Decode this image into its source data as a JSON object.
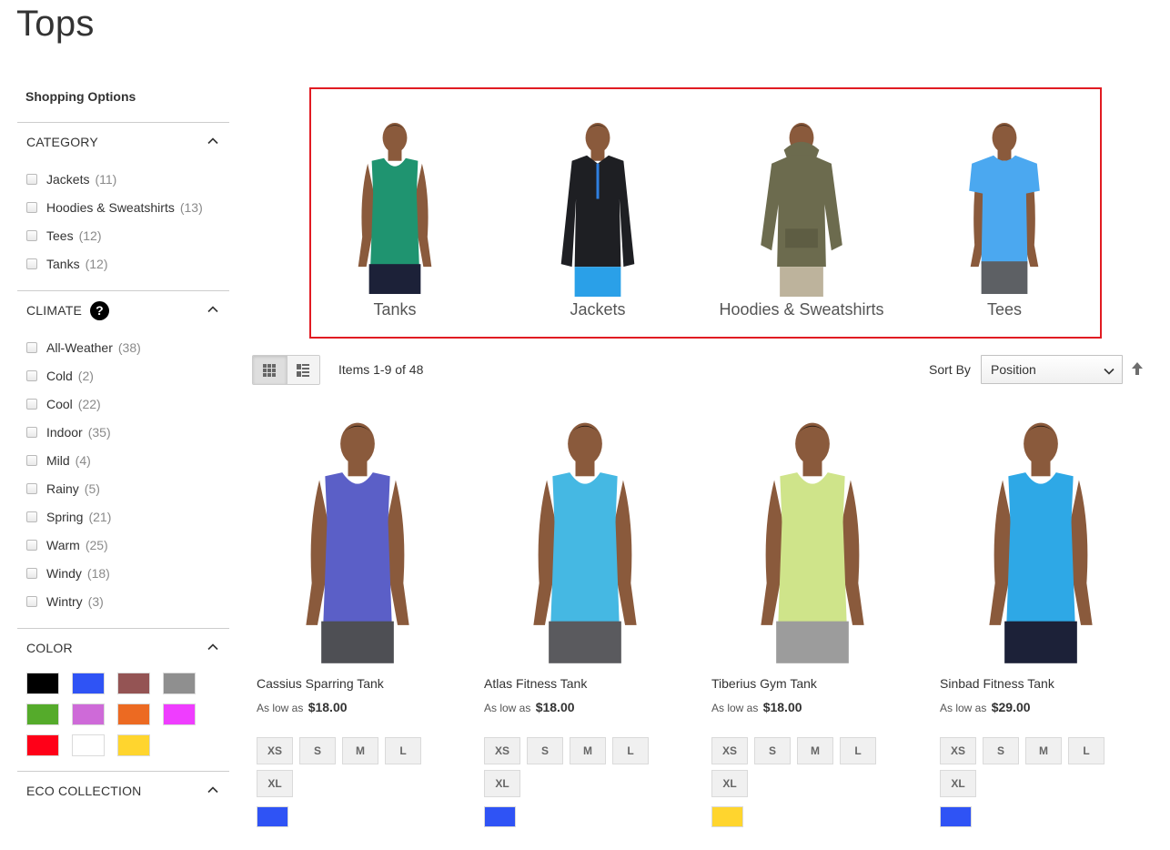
{
  "page": {
    "title": "Tops"
  },
  "sidebar": {
    "heading": "Shopping Options",
    "category": {
      "title": "CATEGORY",
      "options": [
        {
          "label": "Jackets",
          "count": "(11)"
        },
        {
          "label": "Hoodies & Sweatshirts",
          "count": "(13)"
        },
        {
          "label": "Tees",
          "count": "(12)"
        },
        {
          "label": "Tanks",
          "count": "(12)"
        }
      ]
    },
    "climate": {
      "title": "CLIMATE",
      "help_icon": "?",
      "options": [
        {
          "label": "All-Weather",
          "count": "(38)"
        },
        {
          "label": "Cold",
          "count": "(2)"
        },
        {
          "label": "Cool",
          "count": "(22)"
        },
        {
          "label": "Indoor",
          "count": "(35)"
        },
        {
          "label": "Mild",
          "count": "(4)"
        },
        {
          "label": "Rainy",
          "count": "(5)"
        },
        {
          "label": "Spring",
          "count": "(21)"
        },
        {
          "label": "Warm",
          "count": "(25)"
        },
        {
          "label": "Windy",
          "count": "(18)"
        },
        {
          "label": "Wintry",
          "count": "(3)"
        }
      ]
    },
    "color": {
      "title": "COLOR",
      "swatches": [
        "#000000",
        "#2f53f5",
        "#945454",
        "#8f8f8f",
        "#55ab2b",
        "#ce6ad8",
        "#ec6a22",
        "#ef3dff",
        "#ff0018",
        "#ffffff",
        "#ffd52e"
      ]
    },
    "eco": {
      "title": "ECO COLLECTION"
    }
  },
  "categories": {
    "highlight_color": "#e11b22",
    "items": [
      {
        "label": "Tanks",
        "shirt_color": "#1f9470",
        "type": "tank"
      },
      {
        "label": "Jackets",
        "shirt_color": "#1e1f23",
        "type": "jacket"
      },
      {
        "label": "Hoodies & Sweatshirts",
        "shirt_color": "#6c6b4e",
        "type": "hoodie"
      },
      {
        "label": "Tees",
        "shirt_color": "#4ba8f0",
        "type": "tee"
      }
    ]
  },
  "toolbar": {
    "amount": "Items 1-9 of 48",
    "sort_label": "Sort By",
    "sort_value": "Position",
    "grid_icon": "grid-icon",
    "list_icon": "list-icon",
    "sort_direction_icon": "arrow-up-icon"
  },
  "products": [
    {
      "name": "Cassius Sparring Tank",
      "price_prefix": "As low as",
      "price": "$18.00",
      "tank_color": "#5b5fc7",
      "shorts_color": "#4e4f54",
      "sizes": [
        "XS",
        "S",
        "M",
        "L",
        "XL"
      ],
      "swatch": "#2f53f5"
    },
    {
      "name": "Atlas Fitness Tank",
      "price_prefix": "As low as",
      "price": "$18.00",
      "tank_color": "#45b8e3",
      "shorts_color": "#5a5a5e",
      "sizes": [
        "XS",
        "S",
        "M",
        "L",
        "XL"
      ],
      "swatch": "#2f53f5"
    },
    {
      "name": "Tiberius Gym Tank",
      "price_prefix": "As low as",
      "price": "$18.00",
      "tank_color": "#cfe48a",
      "shorts_color": "#9c9c9c",
      "sizes": [
        "XS",
        "S",
        "M",
        "L",
        "XL"
      ],
      "swatch": "#ffd52e"
    },
    {
      "name": "Sinbad Fitness Tank",
      "price_prefix": "As low as",
      "price": "$29.00",
      "tank_color": "#2ea8e6",
      "shorts_color": "#1c2138",
      "sizes": [
        "XS",
        "S",
        "M",
        "L",
        "XL"
      ],
      "swatch": "#2f53f5"
    }
  ]
}
